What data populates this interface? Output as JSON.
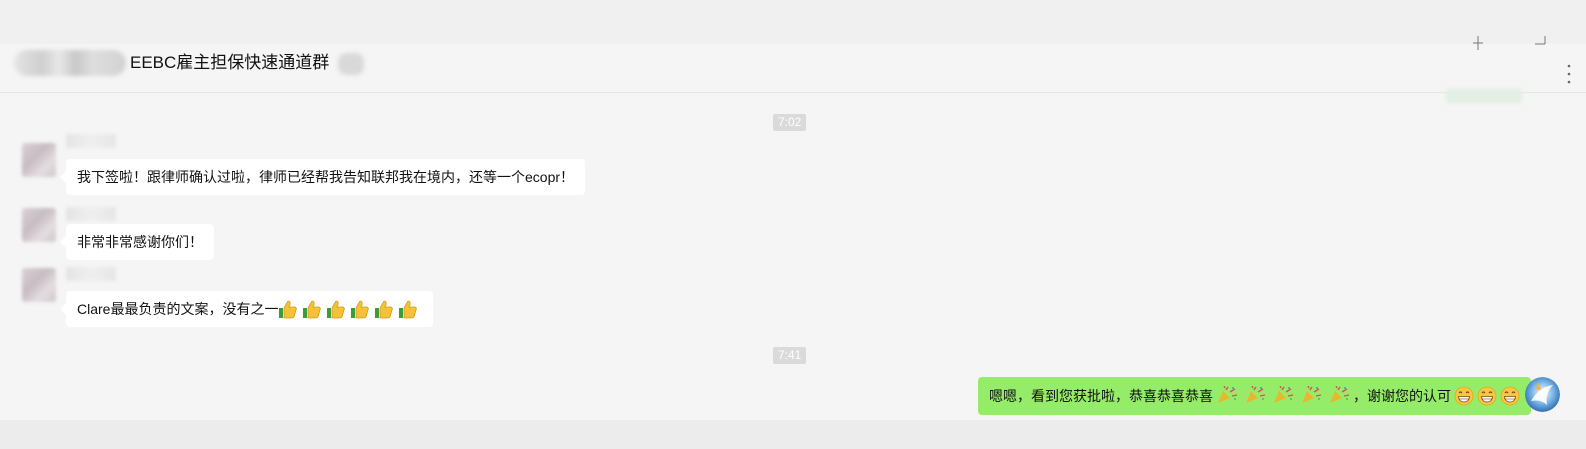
{
  "header": {
    "title": "EEBC雇主担保快速通道群",
    "pin_icon": "pin-icon",
    "more_icon": "more-icon"
  },
  "timestamps": [
    "7:02",
    "7:41"
  ],
  "messages": [
    {
      "side": "left",
      "text": "我下签啦！跟律师确认过啦，律师已经帮我告知联邦我在境内，还等一个ecopr！"
    },
    {
      "side": "left",
      "text": "非常非常感谢你们！"
    },
    {
      "side": "left",
      "text": "Clare最最负责的文案，没有之一",
      "emoji": "thumbs-up",
      "emoji_count": 6
    },
    {
      "side": "right",
      "text_before": "嗯嗯，看到您获批啦，恭喜恭喜恭喜",
      "emoji_mid": "party-popper",
      "emoji_mid_count": 5,
      "text_after": "，谢谢您的认可",
      "emoji_end": "grinning-face",
      "emoji_end_count": 3
    }
  ],
  "colors": {
    "background": "#f5f5f5",
    "bubble_left": "#ffffff",
    "bubble_right": "#95ec69",
    "timestamp_bg": "#dadada"
  }
}
